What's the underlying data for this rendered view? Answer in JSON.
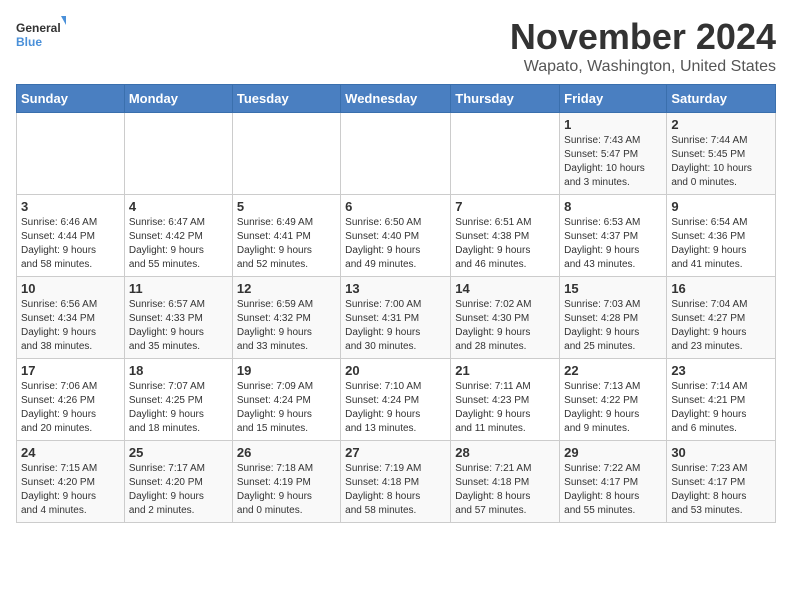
{
  "logo": {
    "text_general": "General",
    "text_blue": "Blue"
  },
  "title": "November 2024",
  "location": "Wapato, Washington, United States",
  "days_of_week": [
    "Sunday",
    "Monday",
    "Tuesday",
    "Wednesday",
    "Thursday",
    "Friday",
    "Saturday"
  ],
  "weeks": [
    [
      {
        "day": "",
        "info": ""
      },
      {
        "day": "",
        "info": ""
      },
      {
        "day": "",
        "info": ""
      },
      {
        "day": "",
        "info": ""
      },
      {
        "day": "",
        "info": ""
      },
      {
        "day": "1",
        "info": "Sunrise: 7:43 AM\nSunset: 5:47 PM\nDaylight: 10 hours\nand 3 minutes."
      },
      {
        "day": "2",
        "info": "Sunrise: 7:44 AM\nSunset: 5:45 PM\nDaylight: 10 hours\nand 0 minutes."
      }
    ],
    [
      {
        "day": "3",
        "info": "Sunrise: 6:46 AM\nSunset: 4:44 PM\nDaylight: 9 hours\nand 58 minutes."
      },
      {
        "day": "4",
        "info": "Sunrise: 6:47 AM\nSunset: 4:42 PM\nDaylight: 9 hours\nand 55 minutes."
      },
      {
        "day": "5",
        "info": "Sunrise: 6:49 AM\nSunset: 4:41 PM\nDaylight: 9 hours\nand 52 minutes."
      },
      {
        "day": "6",
        "info": "Sunrise: 6:50 AM\nSunset: 4:40 PM\nDaylight: 9 hours\nand 49 minutes."
      },
      {
        "day": "7",
        "info": "Sunrise: 6:51 AM\nSunset: 4:38 PM\nDaylight: 9 hours\nand 46 minutes."
      },
      {
        "day": "8",
        "info": "Sunrise: 6:53 AM\nSunset: 4:37 PM\nDaylight: 9 hours\nand 43 minutes."
      },
      {
        "day": "9",
        "info": "Sunrise: 6:54 AM\nSunset: 4:36 PM\nDaylight: 9 hours\nand 41 minutes."
      }
    ],
    [
      {
        "day": "10",
        "info": "Sunrise: 6:56 AM\nSunset: 4:34 PM\nDaylight: 9 hours\nand 38 minutes."
      },
      {
        "day": "11",
        "info": "Sunrise: 6:57 AM\nSunset: 4:33 PM\nDaylight: 9 hours\nand 35 minutes."
      },
      {
        "day": "12",
        "info": "Sunrise: 6:59 AM\nSunset: 4:32 PM\nDaylight: 9 hours\nand 33 minutes."
      },
      {
        "day": "13",
        "info": "Sunrise: 7:00 AM\nSunset: 4:31 PM\nDaylight: 9 hours\nand 30 minutes."
      },
      {
        "day": "14",
        "info": "Sunrise: 7:02 AM\nSunset: 4:30 PM\nDaylight: 9 hours\nand 28 minutes."
      },
      {
        "day": "15",
        "info": "Sunrise: 7:03 AM\nSunset: 4:28 PM\nDaylight: 9 hours\nand 25 minutes."
      },
      {
        "day": "16",
        "info": "Sunrise: 7:04 AM\nSunset: 4:27 PM\nDaylight: 9 hours\nand 23 minutes."
      }
    ],
    [
      {
        "day": "17",
        "info": "Sunrise: 7:06 AM\nSunset: 4:26 PM\nDaylight: 9 hours\nand 20 minutes."
      },
      {
        "day": "18",
        "info": "Sunrise: 7:07 AM\nSunset: 4:25 PM\nDaylight: 9 hours\nand 18 minutes."
      },
      {
        "day": "19",
        "info": "Sunrise: 7:09 AM\nSunset: 4:24 PM\nDaylight: 9 hours\nand 15 minutes."
      },
      {
        "day": "20",
        "info": "Sunrise: 7:10 AM\nSunset: 4:24 PM\nDaylight: 9 hours\nand 13 minutes."
      },
      {
        "day": "21",
        "info": "Sunrise: 7:11 AM\nSunset: 4:23 PM\nDaylight: 9 hours\nand 11 minutes."
      },
      {
        "day": "22",
        "info": "Sunrise: 7:13 AM\nSunset: 4:22 PM\nDaylight: 9 hours\nand 9 minutes."
      },
      {
        "day": "23",
        "info": "Sunrise: 7:14 AM\nSunset: 4:21 PM\nDaylight: 9 hours\nand 6 minutes."
      }
    ],
    [
      {
        "day": "24",
        "info": "Sunrise: 7:15 AM\nSunset: 4:20 PM\nDaylight: 9 hours\nand 4 minutes."
      },
      {
        "day": "25",
        "info": "Sunrise: 7:17 AM\nSunset: 4:20 PM\nDaylight: 9 hours\nand 2 minutes."
      },
      {
        "day": "26",
        "info": "Sunrise: 7:18 AM\nSunset: 4:19 PM\nDaylight: 9 hours\nand 0 minutes."
      },
      {
        "day": "27",
        "info": "Sunrise: 7:19 AM\nSunset: 4:18 PM\nDaylight: 8 hours\nand 58 minutes."
      },
      {
        "day": "28",
        "info": "Sunrise: 7:21 AM\nSunset: 4:18 PM\nDaylight: 8 hours\nand 57 minutes."
      },
      {
        "day": "29",
        "info": "Sunrise: 7:22 AM\nSunset: 4:17 PM\nDaylight: 8 hours\nand 55 minutes."
      },
      {
        "day": "30",
        "info": "Sunrise: 7:23 AM\nSunset: 4:17 PM\nDaylight: 8 hours\nand 53 minutes."
      }
    ]
  ]
}
